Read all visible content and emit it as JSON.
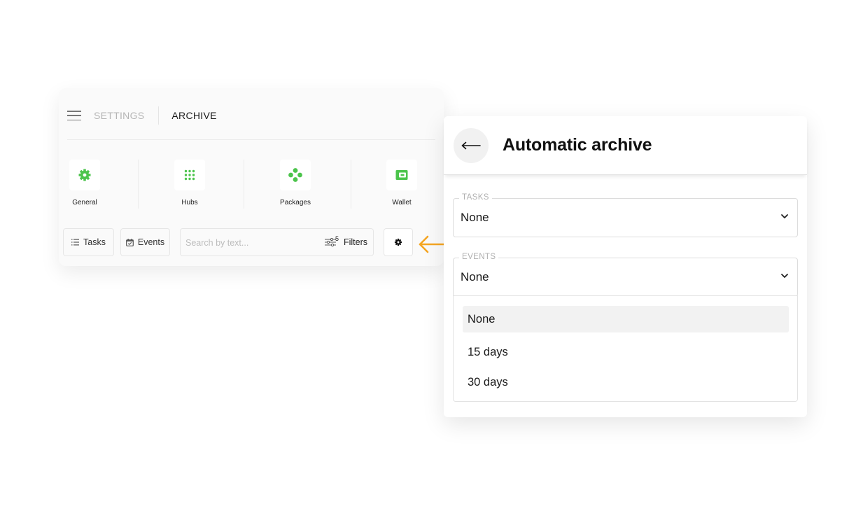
{
  "settings_panel": {
    "breadcrumb": {
      "settings": "SETTINGS",
      "archive": "ARCHIVE"
    },
    "categories": [
      {
        "label": "General",
        "icon": "gear-icon"
      },
      {
        "label": "Hubs",
        "icon": "grid-dots-icon"
      },
      {
        "label": "Packages",
        "icon": "packages-icon"
      },
      {
        "label": "Wallet",
        "icon": "wallet-icon"
      }
    ],
    "accent_color": "#4cc44c",
    "toolbar": {
      "tasks_label": "Tasks",
      "events_label": "Events",
      "search_placeholder": "Search by text...",
      "filters_label": "Filters",
      "filters_count": "5"
    }
  },
  "pointer_color": "#f5a623",
  "archive_panel": {
    "title": "Automatic archive",
    "tasks": {
      "legend": "TASKS",
      "value": "None"
    },
    "events": {
      "legend": "EVENTS",
      "value": "None"
    },
    "options": [
      "None",
      "15 days",
      "30 days"
    ],
    "selected_option": "None"
  }
}
